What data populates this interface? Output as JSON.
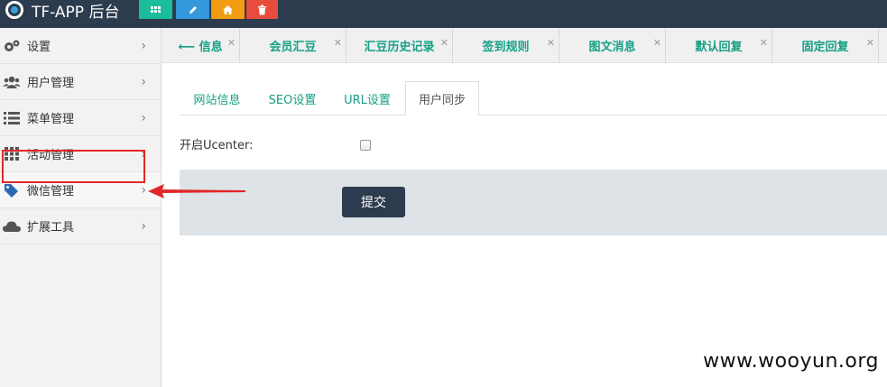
{
  "app": {
    "title": "TF-APP 后台"
  },
  "toolbar": {
    "buttons": [
      {
        "icon": "grid-icon",
        "color": "#1abc9c"
      },
      {
        "icon": "pencil-icon",
        "color": "#3498db"
      },
      {
        "icon": "home-icon",
        "color": "#f39c12"
      },
      {
        "icon": "trash-icon",
        "color": "#e74c3c"
      }
    ]
  },
  "sidebar": {
    "items": [
      {
        "label": "设置",
        "icon": "gears-icon"
      },
      {
        "label": "用户管理",
        "icon": "users-icon"
      },
      {
        "label": "菜单管理",
        "icon": "list-icon"
      },
      {
        "label": "活动管理",
        "icon": "grid-icon"
      },
      {
        "label": "微信管理",
        "icon": "tags-icon",
        "active": true
      },
      {
        "label": "扩展工具",
        "icon": "cloud-icon"
      }
    ]
  },
  "tabs": [
    {
      "label": "⟵ 信息"
    },
    {
      "label": "会员汇豆"
    },
    {
      "label": "汇豆历史记录"
    },
    {
      "label": "签到规则"
    },
    {
      "label": "图文消息"
    },
    {
      "label": "默认回复"
    },
    {
      "label": "固定回复"
    }
  ],
  "subtabs": [
    {
      "label": "网站信息"
    },
    {
      "label": "SEO设置"
    },
    {
      "label": "URL设置"
    },
    {
      "label": "用户同步",
      "active": true
    }
  ],
  "form": {
    "ucenter_label": "开启Ucenter:",
    "ucenter_checked": false,
    "submit_label": "提交"
  },
  "watermark": "www.wooyun.org",
  "colors": {
    "topbar": "#2c3b4d",
    "accent": "#16a085",
    "annotation": "#e12727"
  }
}
